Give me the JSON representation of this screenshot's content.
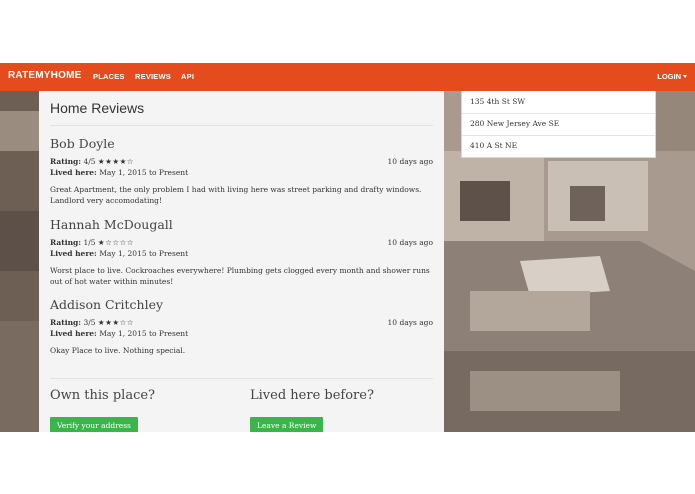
{
  "nav": {
    "brand": "RATEMYHOME",
    "items": [
      "PLACES",
      "REVIEWS",
      "API"
    ],
    "login": "LOGIN"
  },
  "dropdown": {
    "items": [
      "135 4th St SW",
      "280 New Jersey Ave SE",
      "410 A St NE"
    ]
  },
  "panel": {
    "title": "Home Reviews",
    "rating_label": "Rating:",
    "lived_label": "Lived here:",
    "reviews": [
      {
        "name": "Bob Doyle",
        "rating": "4/5",
        "stars": "★★★★☆",
        "date": "10 days ago",
        "lived": "May 1, 2015 to Present",
        "text": "Great Apartment, the only problem I had with living here was street parking and drafty windows. Landlord very accomodating!"
      },
      {
        "name": "Hannah McDougall",
        "rating": "1/5",
        "stars": "★☆☆☆☆",
        "date": "10 days ago",
        "lived": "May 1, 2015 to Present",
        "text": "Worst place to live. Cockroaches everywhere! Plumbing gets clogged every month and shower runs out of hot water within minutes!"
      },
      {
        "name": "Addison Critchley",
        "rating": "3/5",
        "stars": "★★★☆☆",
        "date": "10 days ago",
        "lived": "May 1, 2015 to Present",
        "text": "Okay Place to live. Nothing special."
      }
    ],
    "own_title": "Own this place?",
    "own_button": "Verify your address",
    "lived_title": "Lived here before?",
    "lived_button": "Leave a Review"
  },
  "colors": {
    "navbar": "#e44c1e",
    "button": "#3ab54a",
    "panel": "#f4f4f4"
  },
  "background": "sepia aerial photo of city rooftops"
}
